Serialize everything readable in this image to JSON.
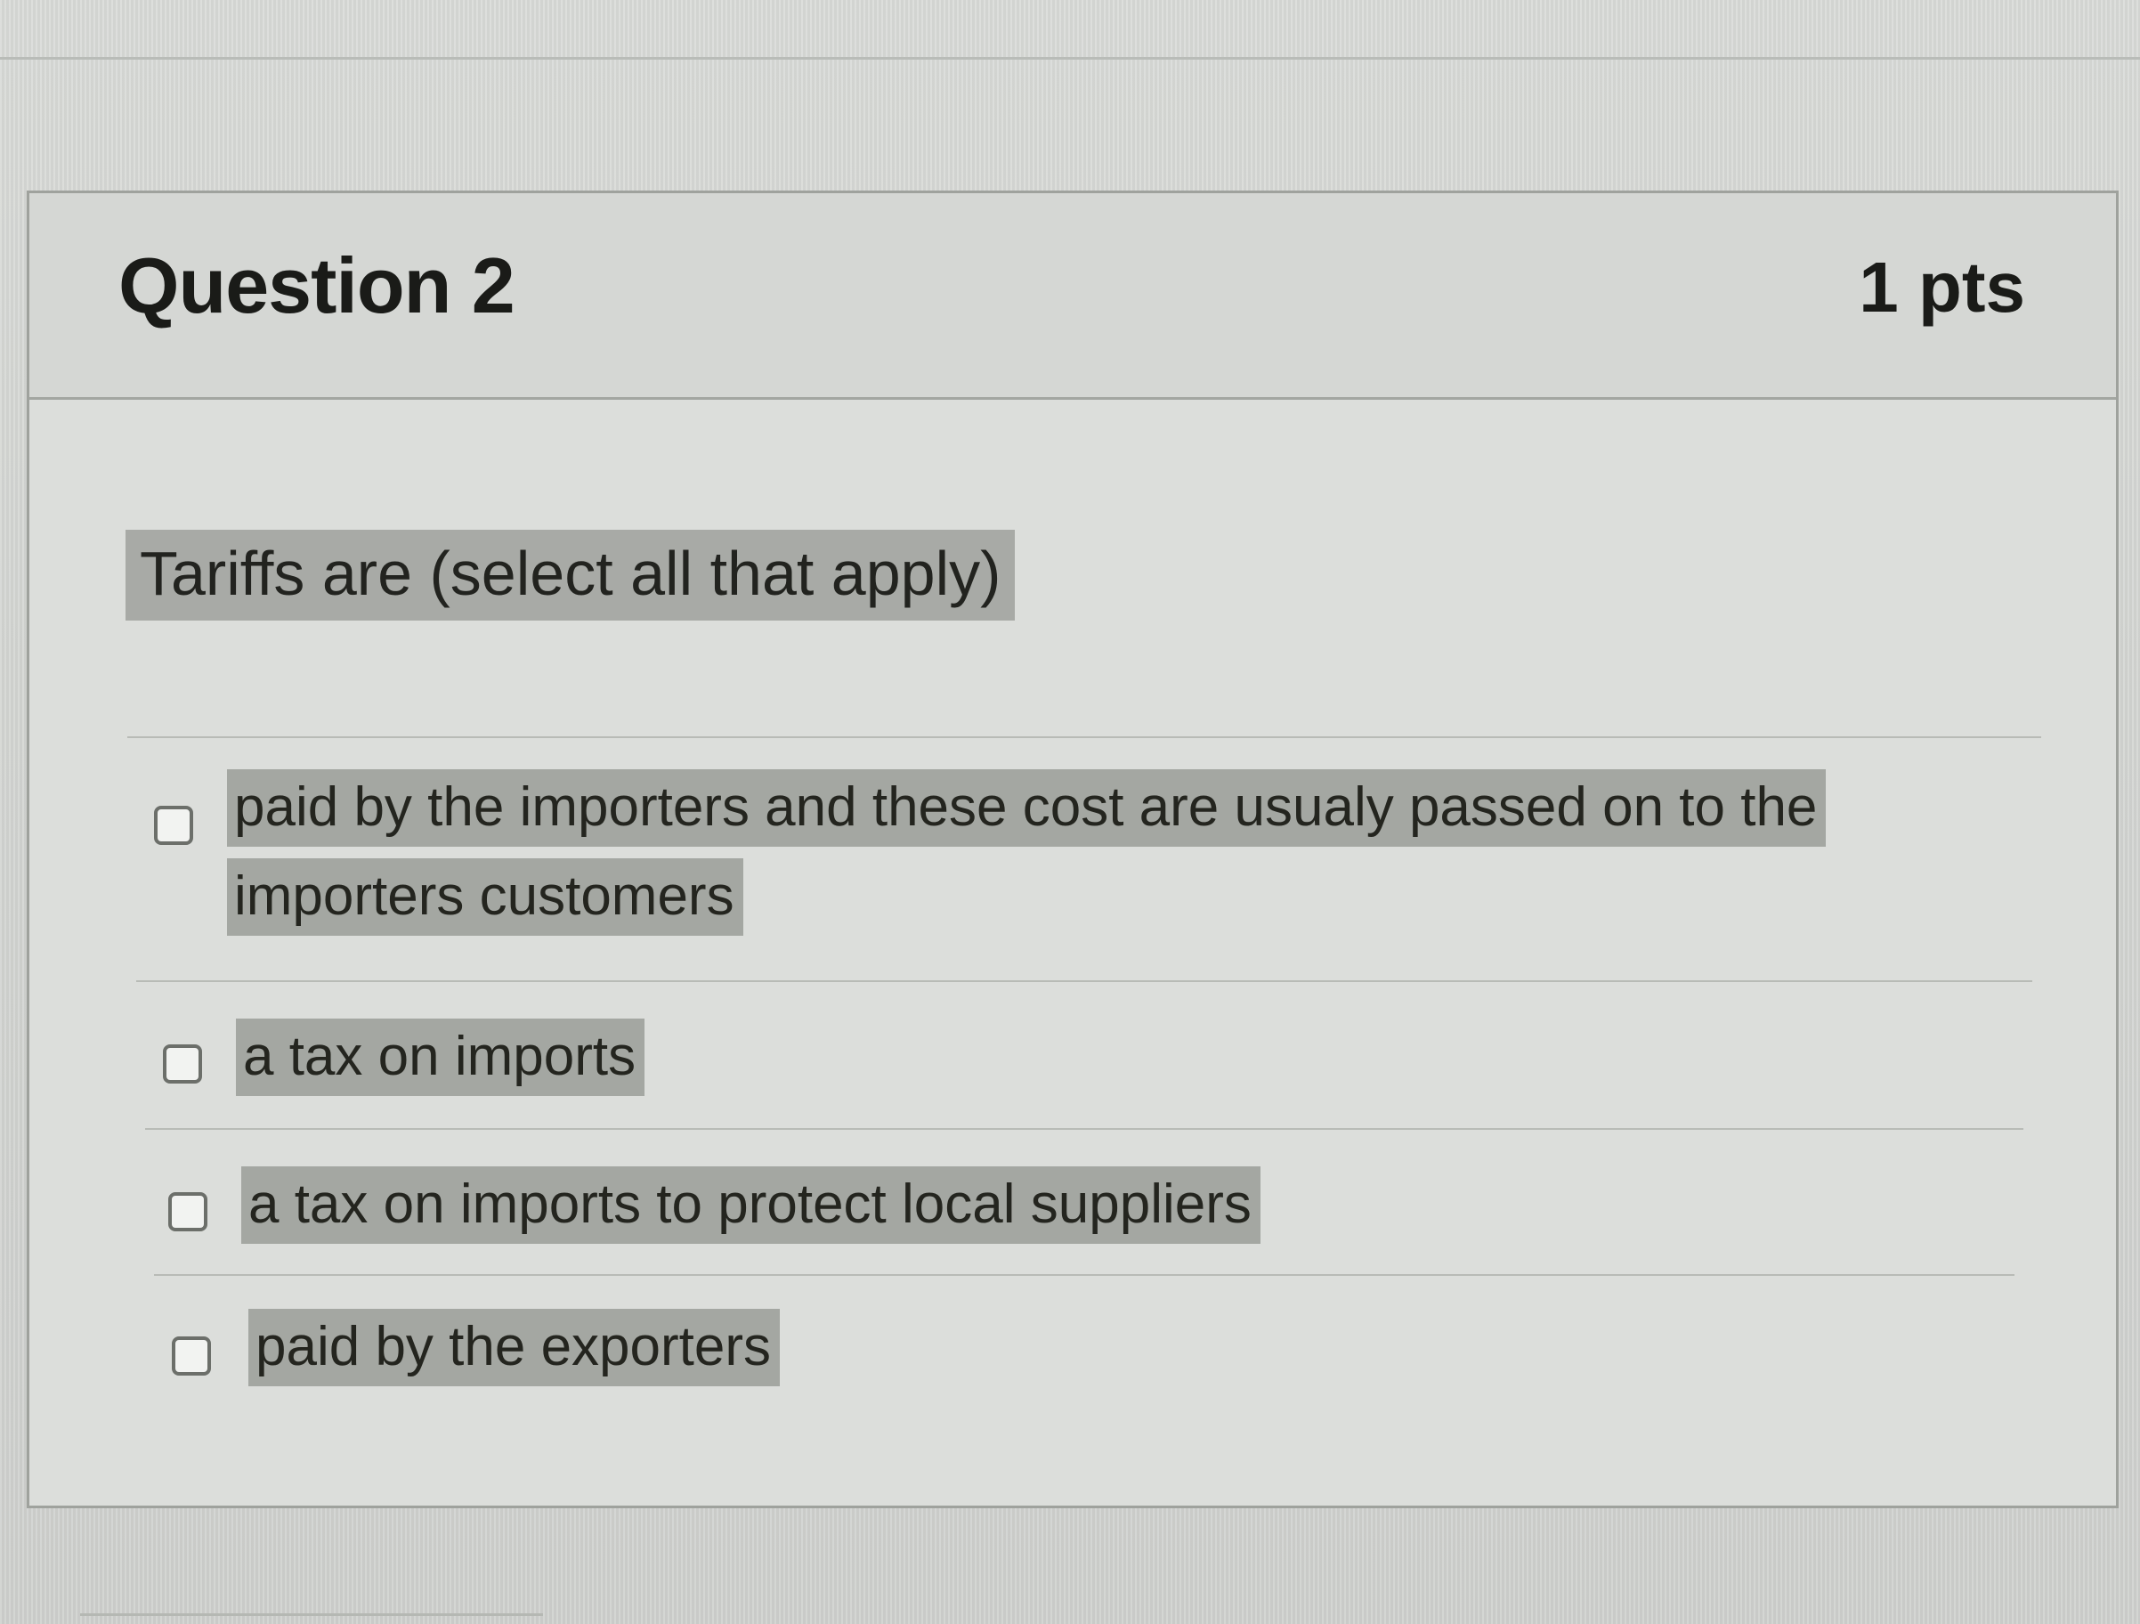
{
  "question": {
    "title": "Question 2",
    "points": "1 pts",
    "prompt": "Tariffs are (select all that apply)"
  },
  "answers": [
    {
      "label": "paid by the importers and these cost are usualy passed on to the importers customers",
      "checked": false
    },
    {
      "label": "a tax on imports",
      "checked": false
    },
    {
      "label": "a tax on imports to protect local suppliers",
      "checked": false
    },
    {
      "label": "paid by the exporters",
      "checked": false
    }
  ],
  "colors": {
    "highlight": "#a4a7a2",
    "card_border": "#9fa29d",
    "text": "#1a1b18"
  }
}
